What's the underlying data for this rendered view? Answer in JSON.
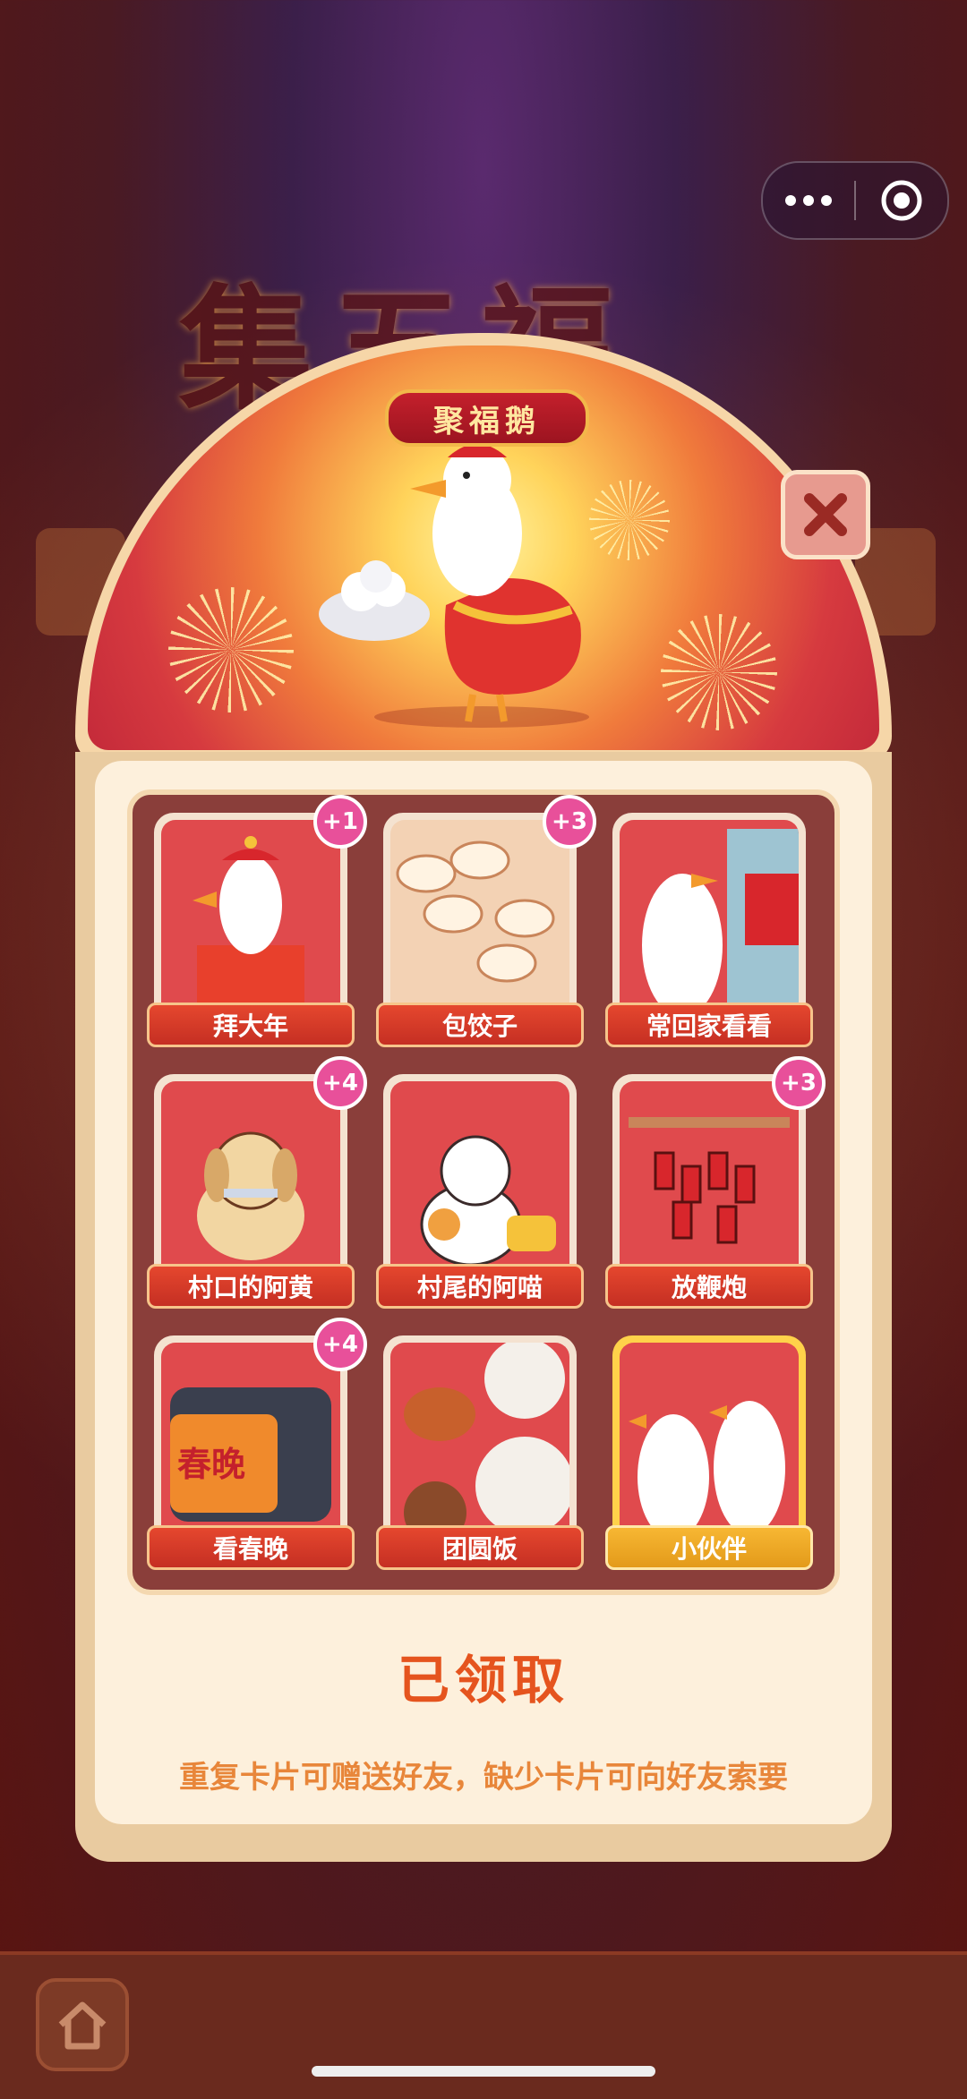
{
  "background_title": "集五福",
  "capsule": {
    "more_icon": "more-dots-icon",
    "target_icon": "target-icon"
  },
  "modal": {
    "banner": "聚福鹅",
    "close_icon": "close-icon",
    "status": "已领取",
    "hint": "重复卡片可赠送好友，缺少卡片可向好友索要"
  },
  "cards": [
    {
      "label": "拜大年",
      "badge": "+1"
    },
    {
      "label": "包饺子",
      "badge": "+3"
    },
    {
      "label": "常回家看看",
      "badge": ""
    },
    {
      "label": "村口的阿黄",
      "badge": "+4"
    },
    {
      "label": "村尾的阿喵",
      "badge": ""
    },
    {
      "label": "放鞭炮",
      "badge": "+3"
    },
    {
      "label": "看春晚",
      "badge": "+4",
      "tv_text": "春晚"
    },
    {
      "label": "团圆饭",
      "badge": ""
    },
    {
      "label": "小伙伴",
      "badge": ""
    }
  ],
  "colors": {
    "accent": "#e5541e",
    "badge": "#e8509a",
    "label": "#d23a26",
    "gold": "#f7b733"
  },
  "bottom": {
    "home_icon": "home-icon"
  }
}
